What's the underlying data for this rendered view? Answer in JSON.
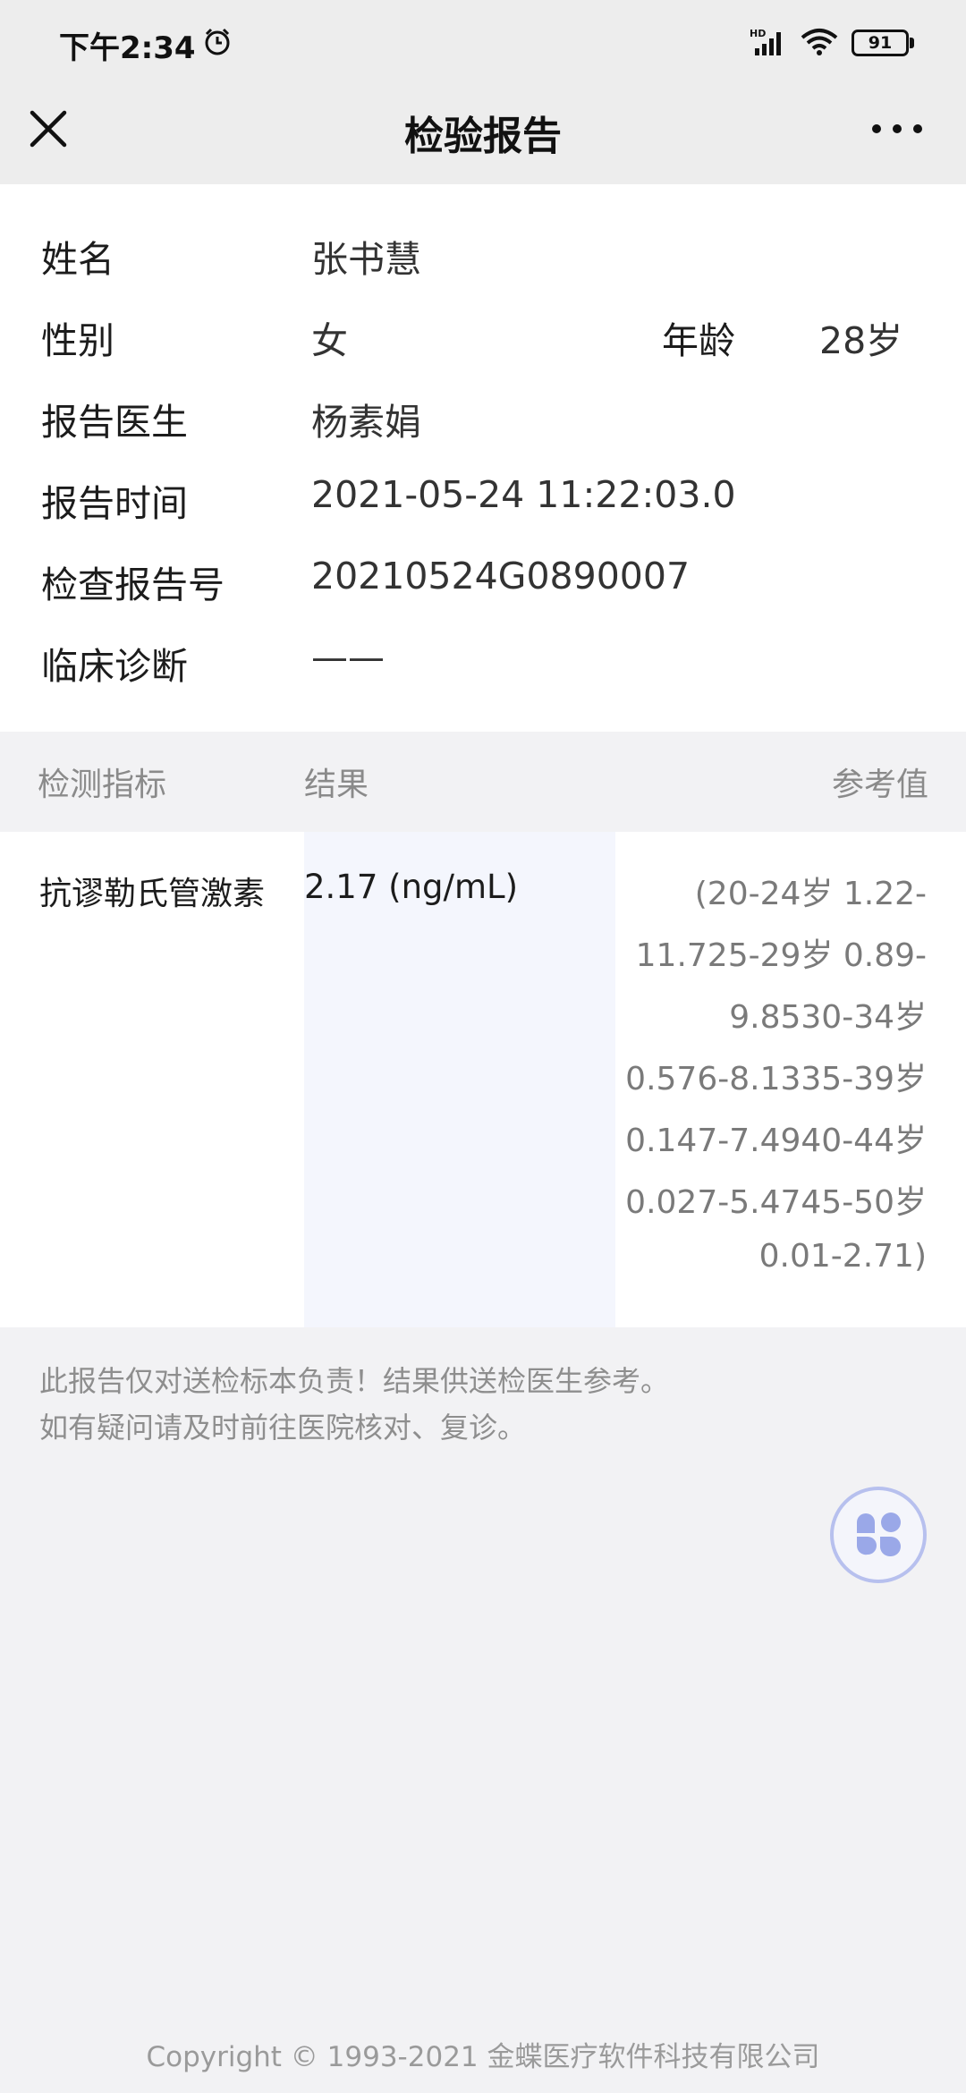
{
  "status_bar": {
    "time": "下午2:34",
    "battery": "91",
    "icons": [
      "alarm-icon",
      "hd-signal-icon",
      "wifi-icon",
      "battery-icon"
    ]
  },
  "header": {
    "title": "检验报告",
    "close_icon": "close-icon",
    "more_icon": "more-icon"
  },
  "patient": {
    "name_label": "姓名",
    "name": "张书慧",
    "gender_label": "性别",
    "gender": "女",
    "age_label": "年龄",
    "age": "28岁",
    "doctor_label": "报告医生",
    "doctor": "杨素娟",
    "report_time_label": "报告时间",
    "report_time": "2021-05-24 11:22:03.0",
    "report_no_label": "检查报告号",
    "report_no": "20210524G0890007",
    "diagnosis_label": "临床诊断",
    "diagnosis": "——"
  },
  "table": {
    "headers": [
      "检测指标",
      "结果",
      "参考值"
    ],
    "rows": [
      {
        "name": "抗谬勒氏管激素",
        "result": "2.17  (ng/mL)",
        "reference_lines": [
          "(20-24岁 1.22-",
          "11.725-29岁 0.89-",
          "9.8530-34岁",
          "0.576-8.1335-39岁",
          "0.147-7.4940-44岁",
          "0.027-5.4745-50岁",
          "0.01-2.71)"
        ]
      }
    ]
  },
  "notice": {
    "line1": "此报告仅对送检标本负责！结果供送检医生参考。",
    "line2": "如有疑问请及时前往医院核对、复诊。"
  },
  "floating_button": {
    "icon": "clover-icon"
  },
  "footer": {
    "copyright": "Copyright © 1993-2021 金蝶医疗软件科技有限公司"
  },
  "colors": {
    "header_bg": "#ededed",
    "page_bg": "#f2f2f4",
    "result_bg": "#f4f6fd",
    "accent": "#9aa8e8"
  }
}
